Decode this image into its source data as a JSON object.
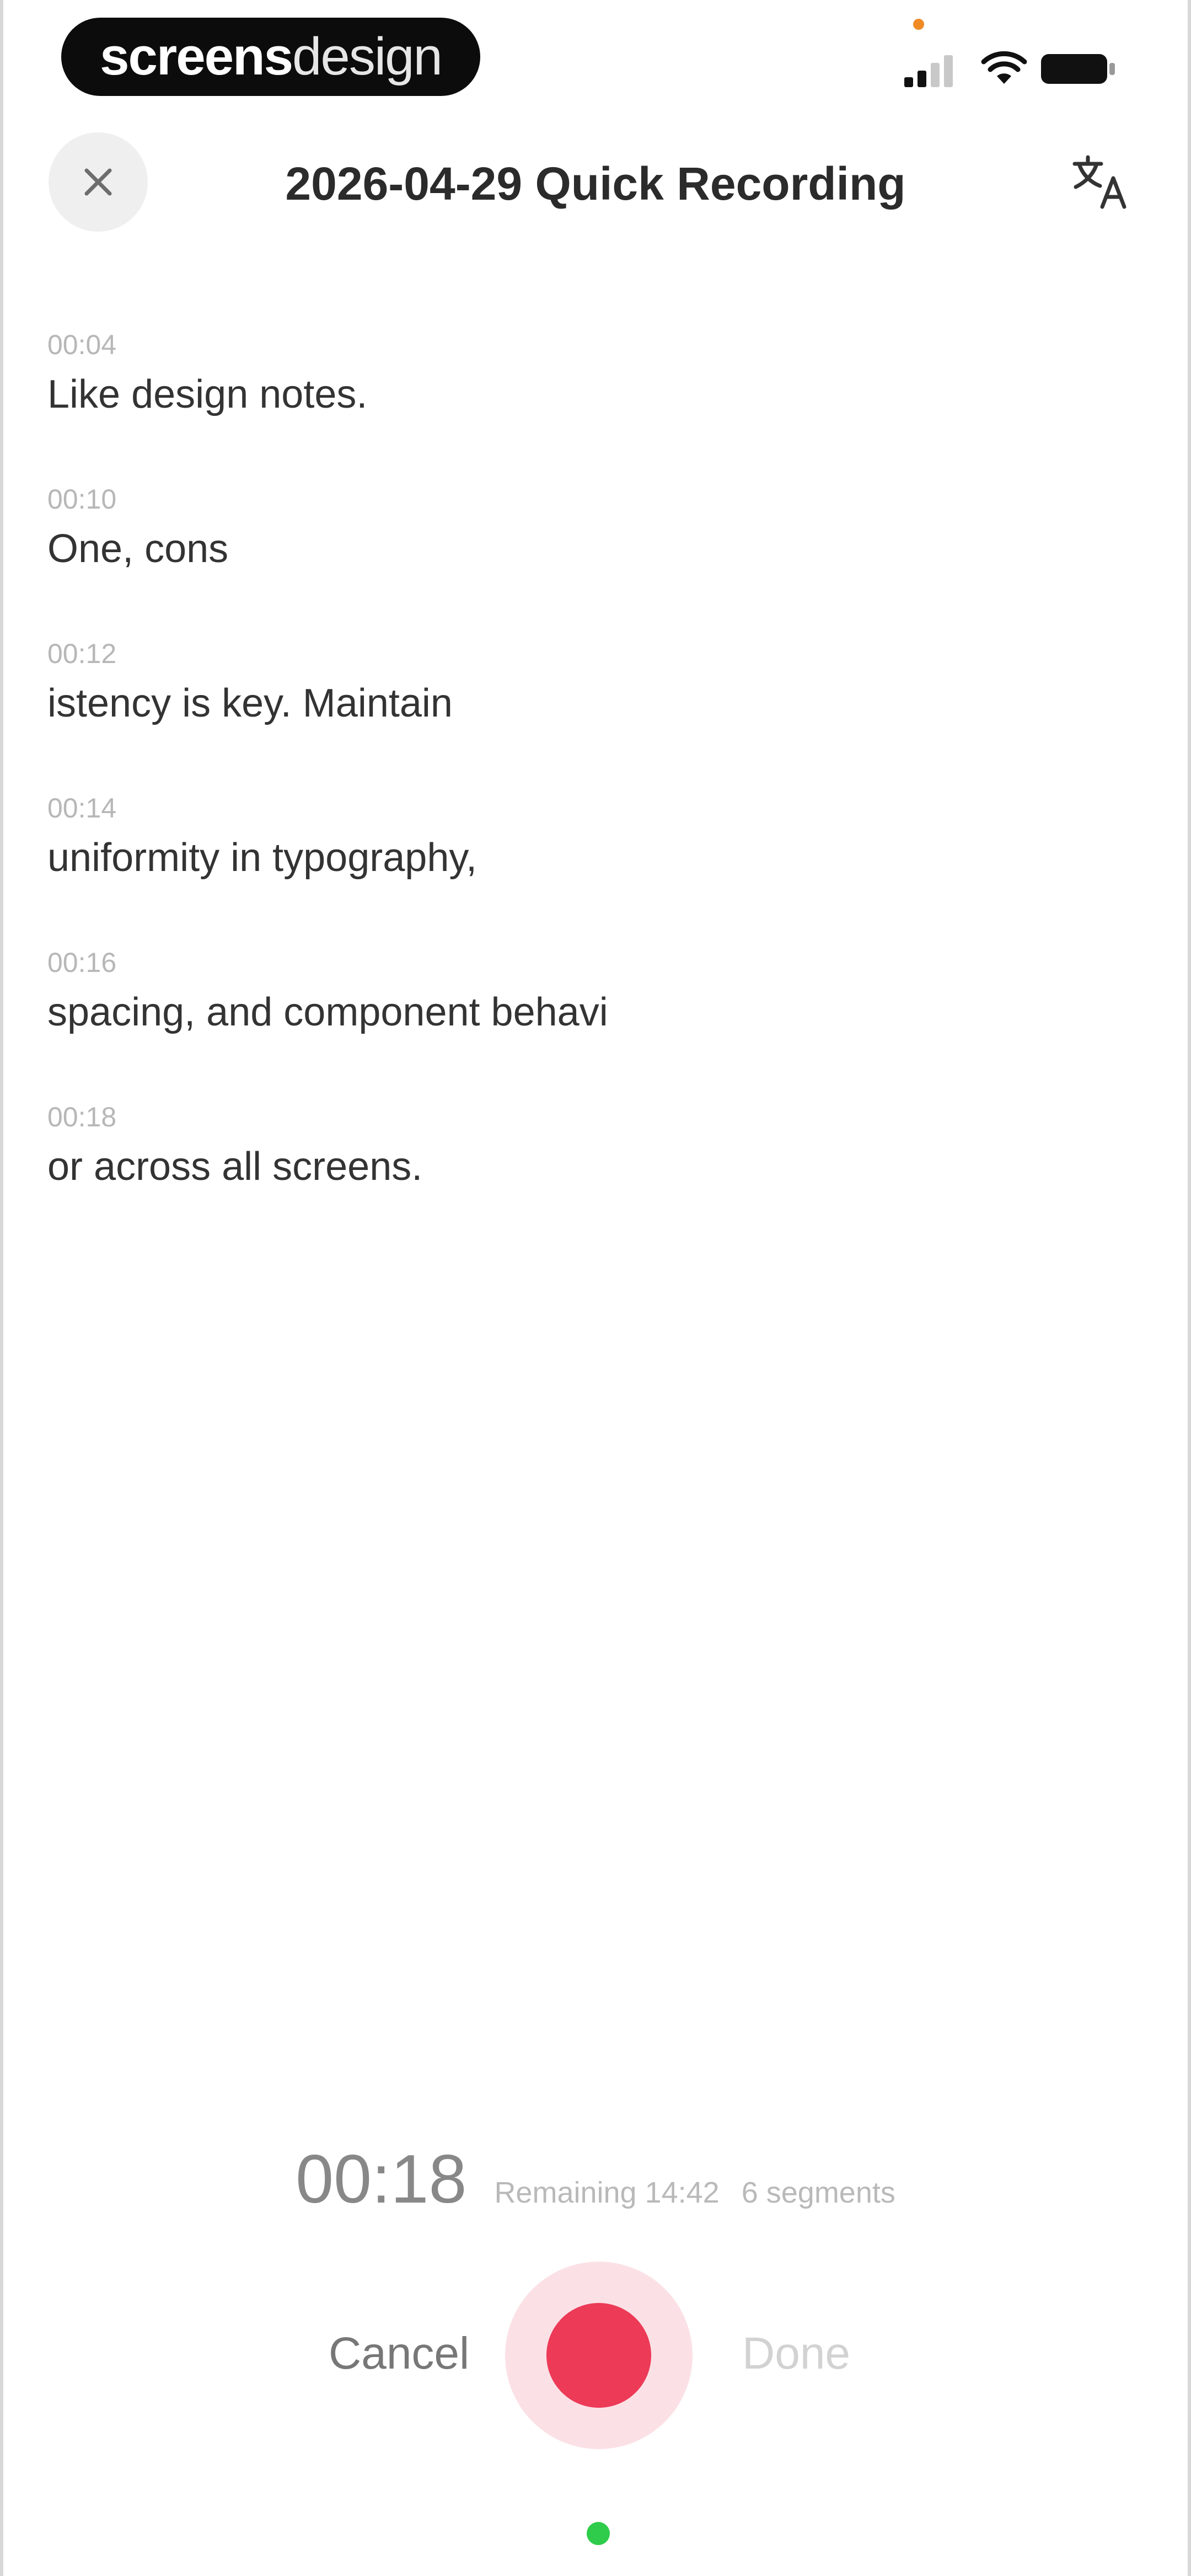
{
  "status_bar": {
    "brand_part1": "screens",
    "brand_part2": "design",
    "colors": {
      "privacy_dot": "#f08a24"
    }
  },
  "header": {
    "title": "2026-04-29 Quick Recording",
    "close_icon": "close-icon",
    "translate_icon": "translate-icon"
  },
  "transcript": {
    "segments": [
      {
        "time": "00:04",
        "text": "Like design notes."
      },
      {
        "time": "00:10",
        "text": "One, cons"
      },
      {
        "time": "00:12",
        "text": "istency is key. Maintain"
      },
      {
        "time": "00:14",
        "text": "uniformity in typography,"
      },
      {
        "time": "00:16",
        "text": "spacing, and component behavi"
      },
      {
        "time": "00:18",
        "text": "or across all screens."
      }
    ]
  },
  "recorder": {
    "elapsed": "00:18",
    "remaining": "Remaining 14:42",
    "segments_count": "6 segments",
    "cancel_label": "Cancel",
    "done_label": "Done",
    "colors": {
      "record_button": "#ec3a57",
      "record_halo": "#fbe1e6",
      "active_indicator": "#2ecc4a"
    }
  }
}
